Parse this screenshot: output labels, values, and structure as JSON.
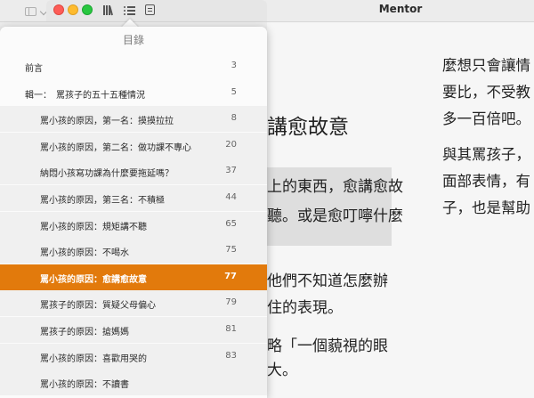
{
  "window": {
    "title": "Mentor"
  },
  "toolbar": {
    "icons": [
      "sidebar-toggle-icon",
      "library-icon",
      "toc-list-icon",
      "notes-icon"
    ]
  },
  "toc": {
    "header": "目錄",
    "items": [
      {
        "title": "前言",
        "page": "3",
        "level": 1
      },
      {
        "title": "輯一：　罵孩子的五十五種情況",
        "page": "5",
        "level": 1
      },
      {
        "title": "罵小孩的原因，第一名：摸摸拉拉",
        "page": "8",
        "level": 2
      },
      {
        "title": "罵小孩的原因，第二名：做功課不專心",
        "page": "20",
        "level": 2
      },
      {
        "title": "納悶小孩寫功課為什麼要拖延嗎？",
        "page": "37",
        "level": 2
      },
      {
        "title": "罵小孩的原因，第三名：不積極",
        "page": "44",
        "level": 2
      },
      {
        "title": "罵小孩的原因：規矩講不聽",
        "page": "65",
        "level": 2
      },
      {
        "title": "罵小孩的原因：不喝水",
        "page": "75",
        "level": 2
      },
      {
        "title": "罵小孩的原因：愈講愈故意",
        "page": "77",
        "level": 2,
        "selected": true
      },
      {
        "title": "罵孩子的原因：質疑父母偏心",
        "page": "79",
        "level": 2
      },
      {
        "title": "罵孩子的原因：搶媽媽",
        "page": "81",
        "level": 2
      },
      {
        "title": "罵小孩的原因：喜歡用哭的",
        "page": "83",
        "level": 2
      },
      {
        "title": "罵小孩的原因：不讀書",
        "page": "",
        "level": 2
      }
    ]
  },
  "book": {
    "chapter_title_fragment": "講愈故意",
    "mid_lines": [
      "上的東西，愈講愈故",
      "聽。或是愈叮嚀什麼",
      "他們不知道怎麼辦",
      "住的表現。",
      "略「一個藐視的眼",
      "大。"
    ],
    "right_lines": [
      "麼想只會讓情",
      "要比，不受教",
      "多一百倍吧。",
      "與其罵孩子，",
      "面部表情，有",
      "子，也是幫助"
    ]
  },
  "colors": {
    "accent": "#e27a0c",
    "traffic_red": "#fd5c57",
    "traffic_yellow": "#febb2e",
    "traffic_green": "#28c740"
  }
}
